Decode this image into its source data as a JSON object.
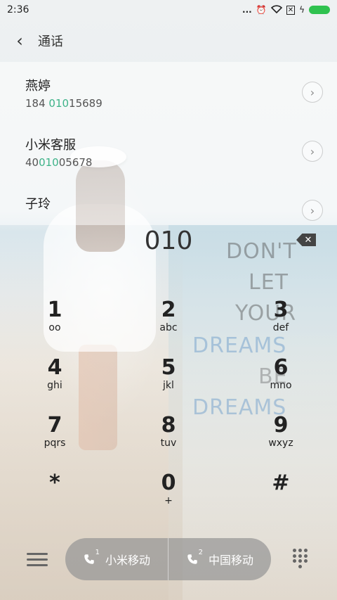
{
  "status": {
    "time": "2:36",
    "dots": "..."
  },
  "header": {
    "title": "通话"
  },
  "contacts": [
    {
      "name": "燕婷",
      "num_pre": "184 ",
      "num_hl": "010",
      "num_post": "15689"
    },
    {
      "name": "小米客服",
      "num_pre": "40",
      "num_hl": "010",
      "num_post": "05678"
    },
    {
      "name": "子玲",
      "num_pre": "",
      "num_hl": "",
      "num_post": ""
    }
  ],
  "dialed": "010",
  "quote": [
    "DON'T",
    "LET",
    "YOUR",
    "DREAMS",
    "BE",
    "DREAMS"
  ],
  "keys": [
    {
      "digit": "1",
      "letters": "oo"
    },
    {
      "digit": "2",
      "letters": "abc"
    },
    {
      "digit": "3",
      "letters": "def"
    },
    {
      "digit": "4",
      "letters": "ghi"
    },
    {
      "digit": "5",
      "letters": "jkl"
    },
    {
      "digit": "6",
      "letters": "mno"
    },
    {
      "digit": "7",
      "letters": "pqrs"
    },
    {
      "digit": "8",
      "letters": "tuv"
    },
    {
      "digit": "9",
      "letters": "wxyz"
    },
    {
      "digit": "*",
      "letters": ""
    },
    {
      "digit": "0",
      "letters": "+"
    },
    {
      "digit": "#",
      "letters": ""
    }
  ],
  "sims": [
    {
      "slot": "1",
      "carrier": "小米移动"
    },
    {
      "slot": "2",
      "carrier": "中国移动"
    }
  ],
  "icons": {
    "back": "chevron-left-icon",
    "contact_arrow": "chevron-right-icon",
    "backspace": "backspace-icon",
    "menu": "menu-icon",
    "dialpad": "dialpad-icon",
    "alarm": "alarm-icon",
    "wifi": "wifi-icon",
    "sim_off": "sim-off-icon",
    "charging": "charging-icon"
  },
  "colors": {
    "highlight": "#3eb389",
    "battery": "#2fc24f"
  }
}
